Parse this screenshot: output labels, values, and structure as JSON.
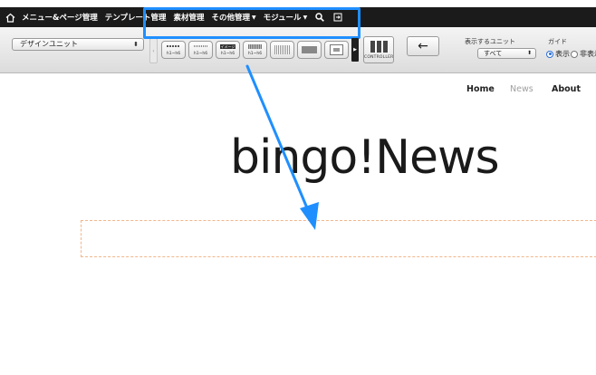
{
  "menubar": {
    "home_icon": "home-icon",
    "items": [
      {
        "label": "メニュー&ページ管理",
        "dropdown": false
      },
      {
        "label": "テンプレート管理",
        "dropdown": false
      },
      {
        "label": "素材管理",
        "dropdown": false
      },
      {
        "label": "その他管理",
        "dropdown": true
      },
      {
        "label": "モジュール",
        "dropdown": true
      }
    ],
    "search_icon": "search-icon",
    "exit_icon": "exit-icon"
  },
  "toolbar": {
    "unit_select_value": "デザインユニット",
    "unit_buttons": [
      {
        "top": "",
        "sub": "h1~h6",
        "style": "dashed"
      },
      {
        "top": "",
        "sub": "h1~h6",
        "style": "dotted"
      },
      {
        "top": "イメージ",
        "sub": "h1~h6",
        "style": "block"
      },
      {
        "top": "",
        "sub": "h1~h6",
        "style": "gray"
      },
      {
        "top": "",
        "sub": "",
        "style": "grid"
      },
      {
        "top": "",
        "sub": "",
        "style": "solid"
      },
      {
        "top": "",
        "sub": "",
        "style": "frame"
      }
    ],
    "controller_label": "CONTROLLER",
    "back_arrow": "←",
    "display_unit_label": "表示するユニット",
    "display_unit_value": "すべて",
    "guide_label": "ガイド",
    "guide_options": [
      {
        "label": "表示",
        "selected": true
      },
      {
        "label": "非表示",
        "selected": false
      }
    ]
  },
  "site": {
    "nav": [
      "Home",
      "News",
      "About"
    ],
    "active_nav": "News",
    "logo": "bingo!News"
  },
  "colors": {
    "menubar_bg": "#1b1b1b",
    "highlight": "#1f8fff",
    "drop_zone_border": "#f2b68a"
  }
}
